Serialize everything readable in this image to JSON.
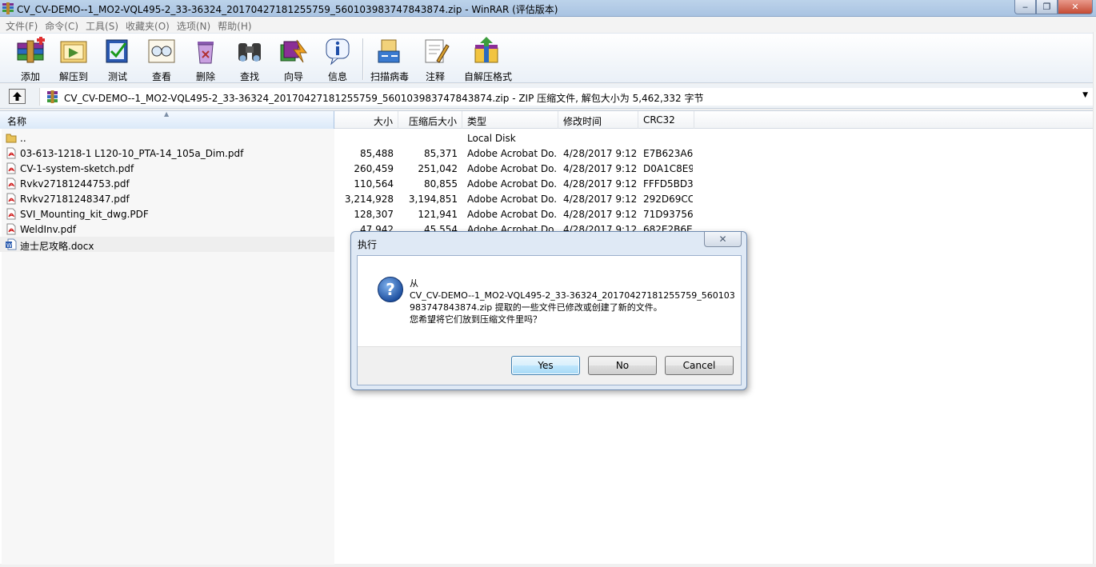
{
  "window": {
    "title": "CV_CV-DEMO--1_MO2-VQL495-2_33-36324_20170427181255759_560103983747843874.zip - WinRAR (评估版本)",
    "controls": {
      "minimize": "‒",
      "maximize": "❐",
      "close": "✕"
    }
  },
  "menu": [
    "文件(F)",
    "命令(C)",
    "工具(S)",
    "收藏夹(O)",
    "选项(N)",
    "帮助(H)"
  ],
  "toolbar": {
    "add": "添加",
    "extract": "解压到",
    "test": "测试",
    "view": "查看",
    "delete": "删除",
    "find": "查找",
    "wizard": "向导",
    "info": "信息",
    "virus_scan": "扫描病毒",
    "comment": "注释",
    "sfx": "自解压格式"
  },
  "address": {
    "text": "CV_CV-DEMO--1_MO2-VQL495-2_33-36324_20170427181255759_560103983747843874.zip - ZIP 压缩文件, 解包大小为 5,462,332 字节"
  },
  "columns": {
    "name": "名称",
    "size": "大小",
    "packed": "压缩后大小",
    "type": "类型",
    "modified": "修改时间",
    "crc": "CRC32"
  },
  "files": [
    {
      "icon": "folder-icon",
      "name": "..",
      "size": "",
      "packed": "",
      "type": "Local Disk",
      "modified": "",
      "crc": ""
    },
    {
      "icon": "pdf-icon",
      "name": "03-613-1218-1 L120-10_PTA-14_105a_Dim.pdf",
      "size": "85,488",
      "packed": "85,371",
      "type": "Adobe Acrobat Do...",
      "modified": "4/28/2017 9:12 ...",
      "crc": "E7B623A6"
    },
    {
      "icon": "pdf-icon",
      "name": "CV-1-system-sketch.pdf",
      "size": "260,459",
      "packed": "251,042",
      "type": "Adobe Acrobat Do...",
      "modified": "4/28/2017 9:12 ...",
      "crc": "D0A1C8E9"
    },
    {
      "icon": "pdf-icon",
      "name": "Rvkv27181244753.pdf",
      "size": "110,564",
      "packed": "80,855",
      "type": "Adobe Acrobat Do...",
      "modified": "4/28/2017 9:12 ...",
      "crc": "FFFD5BD3"
    },
    {
      "icon": "pdf-icon",
      "name": "Rvkv27181248347.pdf",
      "size": "3,214,928",
      "packed": "3,194,851",
      "type": "Adobe Acrobat Do...",
      "modified": "4/28/2017 9:12 ...",
      "crc": "292D69CC"
    },
    {
      "icon": "pdf-icon",
      "name": "SVI_Mounting_kit_dwg.PDF",
      "size": "128,307",
      "packed": "121,941",
      "type": "Adobe Acrobat Do...",
      "modified": "4/28/2017 9:12 ...",
      "crc": "71D93756"
    },
    {
      "icon": "pdf-icon",
      "name": "WeldInv.pdf",
      "size": "47,942",
      "packed": "45,554",
      "type": "Adobe Acrobat Do...",
      "modified": "4/28/2017 9:12 ...",
      "crc": "682E2B6E"
    },
    {
      "icon": "word-icon",
      "name": "迪士尼攻略.docx",
      "size": "",
      "packed": "",
      "type": "",
      "modified": "",
      "crc": ""
    }
  ],
  "dialog": {
    "title": "执行",
    "close": "✕",
    "message_lines": [
      "从",
      "CV_CV-DEMO--1_MO2-VQL495-2_33-36324_20170427181255759_560103",
      "983747843874.zip 提取的一些文件已修改或创建了新的文件。",
      "您希望将它们放到压缩文件里吗？"
    ],
    "buttons": {
      "yes": "Yes",
      "no": "No",
      "cancel": "Cancel"
    }
  },
  "colors": {
    "titlebar": "#bcd3ea",
    "dialog_frame": "#dfe9f5",
    "default_button": "#bee6fd",
    "close_button": "#c44a33"
  }
}
